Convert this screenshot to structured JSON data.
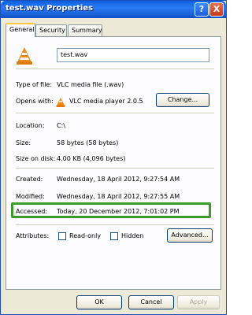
{
  "window": {
    "title": "test.wav Properties",
    "help_label": "?",
    "close_label": "X"
  },
  "tabs": [
    {
      "label": "General"
    },
    {
      "label": "Security"
    },
    {
      "label": "Summary"
    }
  ],
  "general": {
    "filename": "test.wav",
    "type_label": "Type of file:",
    "type_value": "VLC media file (.wav)",
    "opens_label": "Opens with:",
    "opens_value": "VLC media player 2.0.5",
    "change_label": "Change...",
    "location_label": "Location:",
    "location_value": "C:\\",
    "size_label": "Size:",
    "size_value": "58 bytes (58 bytes)",
    "size_disk_label": "Size on disk:",
    "size_disk_value": "4.00 KB (4,096 bytes)",
    "created_label": "Created:",
    "created_value": "Wednesday, 18 April 2012, 9:27:54 AM",
    "modified_label": "Modified:",
    "modified_value": "Wednesday, 18 April 2012, 9:27:55 AM",
    "accessed_label": "Accessed:",
    "accessed_value": "Today, 20 December 2012, 7:01:02 PM",
    "attributes_label": "Attributes:",
    "readonly_label": "Read-only",
    "hidden_label": "Hidden",
    "advanced_label": "Advanced..."
  },
  "footer": {
    "ok_label": "OK",
    "cancel_label": "Cancel",
    "apply_label": "Apply"
  },
  "colors": {
    "highlight": "#3c9b2a",
    "titlebar": "#0b5fe0",
    "vlc_orange": "#f28a1a"
  }
}
